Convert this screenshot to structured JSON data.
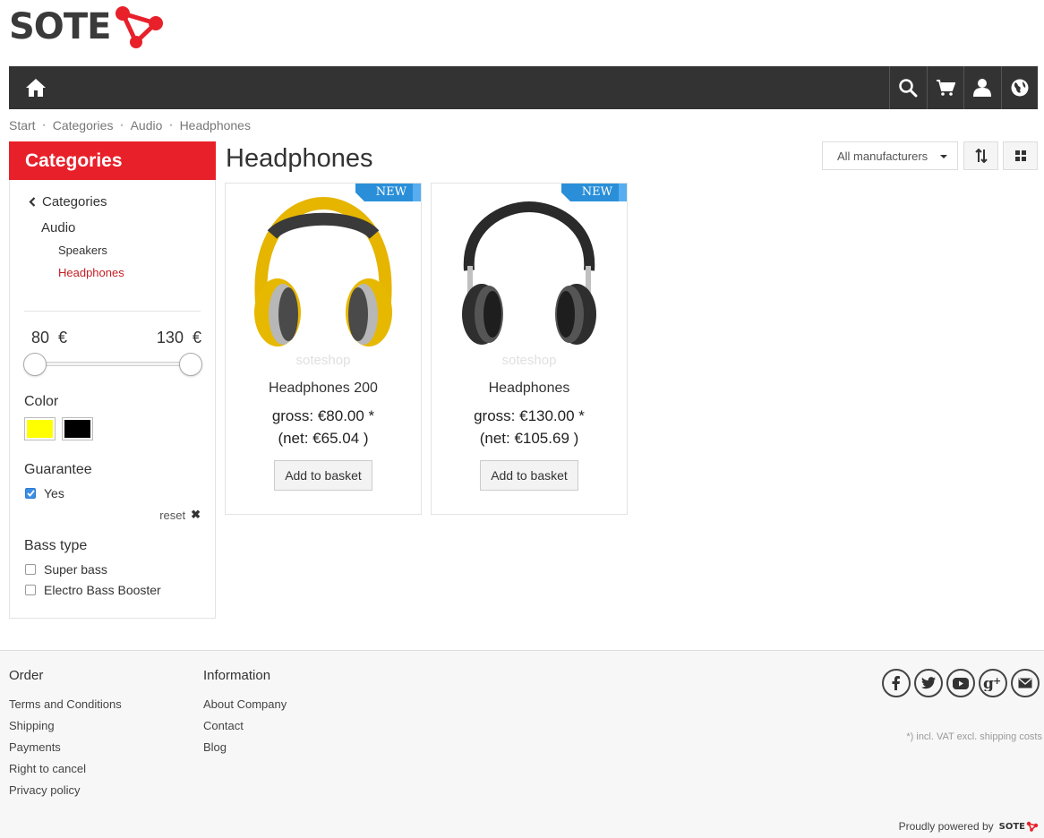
{
  "brand": {
    "logo_text": "SOTE",
    "accent": "#e8202a"
  },
  "navbar": {
    "home_icon": "home-icon",
    "icons": [
      "search-icon",
      "cart-icon",
      "user-icon",
      "globe-icon"
    ]
  },
  "breadcrumb": [
    "Start",
    "Categories",
    "Audio",
    "Headphones"
  ],
  "sidebar": {
    "header": "Categories",
    "back_label": "Categories",
    "parent": "Audio",
    "children": [
      {
        "label": "Speakers",
        "active": false
      },
      {
        "label": "Headphones",
        "active": true
      }
    ],
    "price": {
      "min": "80",
      "max": "130",
      "currency": "€"
    },
    "color_title": "Color",
    "colors": [
      "#ffff00",
      "#000000"
    ],
    "guarantee_title": "Guarantee",
    "guarantee_options": [
      {
        "label": "Yes",
        "checked": true
      }
    ],
    "reset_label": "reset",
    "bass_title": "Bass type",
    "bass_options": [
      {
        "label": "Super bass",
        "checked": false
      },
      {
        "label": "Electro Bass Booster",
        "checked": false
      }
    ]
  },
  "main": {
    "title": "Headphones",
    "manufacturer_select": "All manufacturers",
    "products": [
      {
        "badge": "NEW",
        "watermark": "soteshop",
        "name": "Headphones 200",
        "gross": "gross: €80.00 *",
        "net": "(net: €65.04 )",
        "button": "Add to basket",
        "color": "yellow"
      },
      {
        "badge": "NEW",
        "watermark": "soteshop",
        "name": "Headphones",
        "gross": "gross: €130.00 *",
        "net": "(net: €105.69 )",
        "button": "Add to basket",
        "color": "black"
      }
    ]
  },
  "footer": {
    "order_title": "Order",
    "order_links": [
      "Terms and Conditions",
      "Shipping",
      "Payments",
      "Right to cancel",
      "Privacy policy"
    ],
    "info_title": "Information",
    "info_links": [
      "About Company",
      "Contact",
      "Blog"
    ],
    "social": [
      "facebook-icon",
      "twitter-icon",
      "youtube-icon",
      "google-plus-icon",
      "email-icon"
    ],
    "vat_note": "*) incl. VAT excl. shipping costs",
    "powered_by": "Proudly powered by",
    "powered_logo": "SOTE"
  }
}
